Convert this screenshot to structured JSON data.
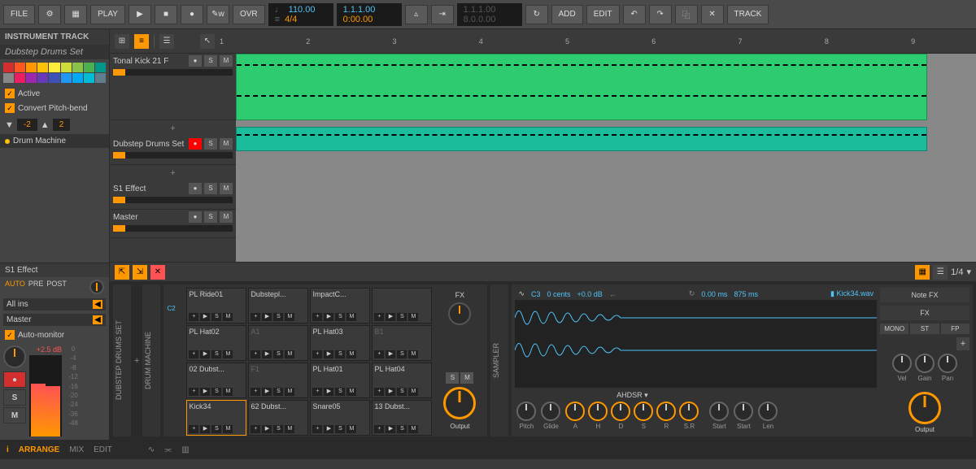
{
  "toolbar": {
    "file": "FILE",
    "play": "PLAY",
    "ovr": "OVR",
    "tempo": "110.00",
    "sig": "4/4",
    "position": "1.1.1.00",
    "time": "0:00.00",
    "loop_start": "1.1.1.00",
    "loop_end": "8.0.0.00",
    "add": "ADD",
    "edit": "EDIT",
    "track": "TRACK"
  },
  "inspector": {
    "header": "INSTRUMENT TRACK",
    "track_name": "Dubstep Drums Set",
    "active": "Active",
    "convert_pitch": "Convert Pitch-bend",
    "pitch_down": "-2",
    "pitch_up": "2",
    "device": "Drum Machine",
    "fx_track": "S1 Effect",
    "auto": "AUTO",
    "pre": "PRE",
    "post": "POST",
    "all_ins": "All ins",
    "master": "Master",
    "auto_monitor": "Auto-monitor",
    "db": "+2.5 dB",
    "meter_ticks": [
      "0",
      "-4",
      "-8",
      "-12",
      "-16",
      "-20",
      "-24",
      "-36",
      "-48"
    ]
  },
  "timeline_markers": [
    "1",
    "2",
    "3",
    "4",
    "5",
    "6",
    "7",
    "8",
    "9"
  ],
  "tracks": [
    {
      "name": "Tonal Kick 21 F",
      "rec": false,
      "volume": 10
    },
    {
      "name": "Dubstep Drums Set",
      "rec": true,
      "volume": 10
    },
    {
      "name": "S1 Effect",
      "rec": false,
      "volume": 10
    },
    {
      "name": "Master",
      "rec": false,
      "volume": 10
    }
  ],
  "detail_zoom": "1/4",
  "drum_machine": {
    "label": "DUBSTEP DRUMS SET",
    "sublabel": "DRUM MACHINE",
    "note_col": [
      "C2",
      "",
      "",
      ""
    ],
    "pads": [
      [
        {
          "name": "PL Ride01"
        },
        {
          "name": "Dubstepl..."
        },
        {
          "name": "ImpactC..."
        },
        {
          "name": ""
        }
      ],
      [
        {
          "name": "PL Hat02"
        },
        {
          "name": "A1",
          "dim": true
        },
        {
          "name": "PL Hat03"
        },
        {
          "name": "B1",
          "dim": true
        }
      ],
      [
        {
          "name": "02 Dubst..."
        },
        {
          "name": "F1",
          "dim": true
        },
        {
          "name": "PL Hat01"
        },
        {
          "name": "PL Hat04"
        }
      ],
      [
        {
          "name": "Kick34",
          "selected": true
        },
        {
          "name": "62 Dubst..."
        },
        {
          "name": "Snare05"
        },
        {
          "name": "13 Dubst..."
        }
      ]
    ],
    "fx": "FX",
    "s": "S",
    "m": "M",
    "output": "Output"
  },
  "sampler": {
    "label": "SAMPLER",
    "note": "C3",
    "cents": "0 cents",
    "gain": "+0.0 dB",
    "start_ms": "0.00 ms",
    "end_ms": "875 ms",
    "file": "Kick34.wav",
    "envelope": "AHDSR",
    "knobs_left": [
      "Pitch",
      "Glide"
    ],
    "knobs_env": [
      "A",
      "H",
      "D",
      "S",
      "R",
      "S.R"
    ],
    "knobs_play": [
      "Start",
      "Start",
      "Len"
    ],
    "note_fx": "Note FX",
    "fx": "FX",
    "modes": [
      "MONO",
      "ST",
      "FP"
    ],
    "out_knobs": [
      "Vel",
      "Gain",
      "Pan"
    ],
    "output": "Output"
  },
  "bottom": {
    "arrange": "ARRANGE",
    "mix": "MIX",
    "edit": "EDIT"
  },
  "colors": [
    "#d32f2f",
    "#ff5722",
    "#ff9800",
    "#ffc107",
    "#ffeb3b",
    "#cddc39",
    "#8bc34a",
    "#4caf50",
    "#009688",
    "#888",
    "#e91e63",
    "#9c27b0",
    "#673ab7",
    "#3f51b5",
    "#2196f3",
    "#03a9f4",
    "#00bcd4",
    "#607d8b"
  ]
}
